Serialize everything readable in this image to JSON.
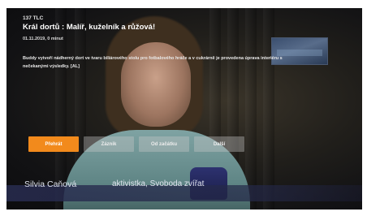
{
  "program": {
    "channel": "137  TLC",
    "title": "Král dortů : Malíř, kuželník a růžová!",
    "meta": "01.11.2019, 0 minut",
    "description": "Buddy vytvoří nádherný dort ve tvaru biliárového stolu pro fotbalového hráče a v cukrárně je provedena úprava interiéru s nečekanými výsledky. [AL]"
  },
  "buttons": [
    {
      "label": "Přehrát",
      "active": true
    },
    {
      "label": "Záznik",
      "active": false
    },
    {
      "label": "Od začátku",
      "active": false
    },
    {
      "label": "Další",
      "active": false
    }
  ],
  "lower_third": {
    "name": "Silvia Caňová",
    "role": "aktivistka, Svoboda zvířat"
  },
  "colors": {
    "accent": "#f28a1c",
    "button_inactive": "#c8c8c8",
    "lower_third": "#2a2e52"
  }
}
